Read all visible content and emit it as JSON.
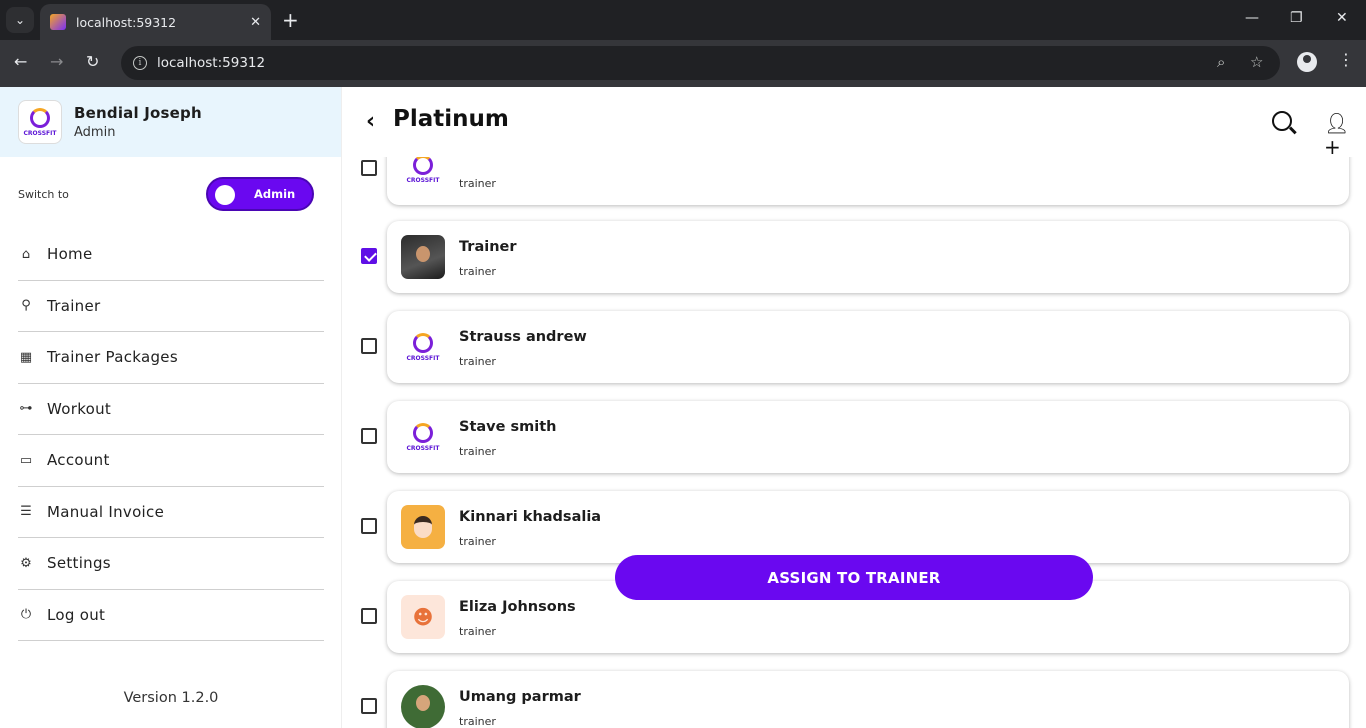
{
  "browser": {
    "tab_title": "localhost:59312",
    "url": "localhost:59312",
    "new_tab": "+",
    "tab_close": "✕"
  },
  "sidebar": {
    "profile": {
      "name": "Bendial Joseph",
      "role": "Admin",
      "logo_text": "CROSSFIT"
    },
    "switch_label": "Switch to",
    "switch_value": "Admin",
    "items": [
      {
        "label": "Home",
        "icon": "home-icon"
      },
      {
        "label": "Trainer",
        "icon": "trainer-icon"
      },
      {
        "label": "Trainer Packages",
        "icon": "calendar-check-icon"
      },
      {
        "label": "Workout",
        "icon": "dumbbell-icon"
      },
      {
        "label": "Account",
        "icon": "money-icon"
      },
      {
        "label": "Manual Invoice",
        "icon": "invoice-icon"
      },
      {
        "label": "Settings",
        "icon": "gear-icon"
      },
      {
        "label": "Log out",
        "icon": "power-icon"
      }
    ],
    "version": "Version 1.2.0"
  },
  "main": {
    "title": "Platinum",
    "assign_label": "ASSIGN TO TRAINER",
    "trainers": [
      {
        "name": "",
        "sub": "trainer",
        "checked": false,
        "avatar": "logo"
      },
      {
        "name": "Trainer",
        "sub": "trainer",
        "checked": true,
        "avatar": "photo"
      },
      {
        "name": "Strauss andrew",
        "sub": "trainer",
        "checked": false,
        "avatar": "logo"
      },
      {
        "name": "Stave smith",
        "sub": "trainer",
        "checked": false,
        "avatar": "logo"
      },
      {
        "name": "Kinnari khadsalia",
        "sub": "trainer",
        "checked": false,
        "avatar": "cartoon"
      },
      {
        "name": "Eliza Johnsons",
        "sub": "trainer",
        "checked": false,
        "avatar": "chef"
      },
      {
        "name": "Umang parmar",
        "sub": "trainer",
        "checked": false,
        "avatar": "man"
      }
    ]
  },
  "colors": {
    "accent": "#6a08f0",
    "profile_bg": "#e8f5fd"
  }
}
